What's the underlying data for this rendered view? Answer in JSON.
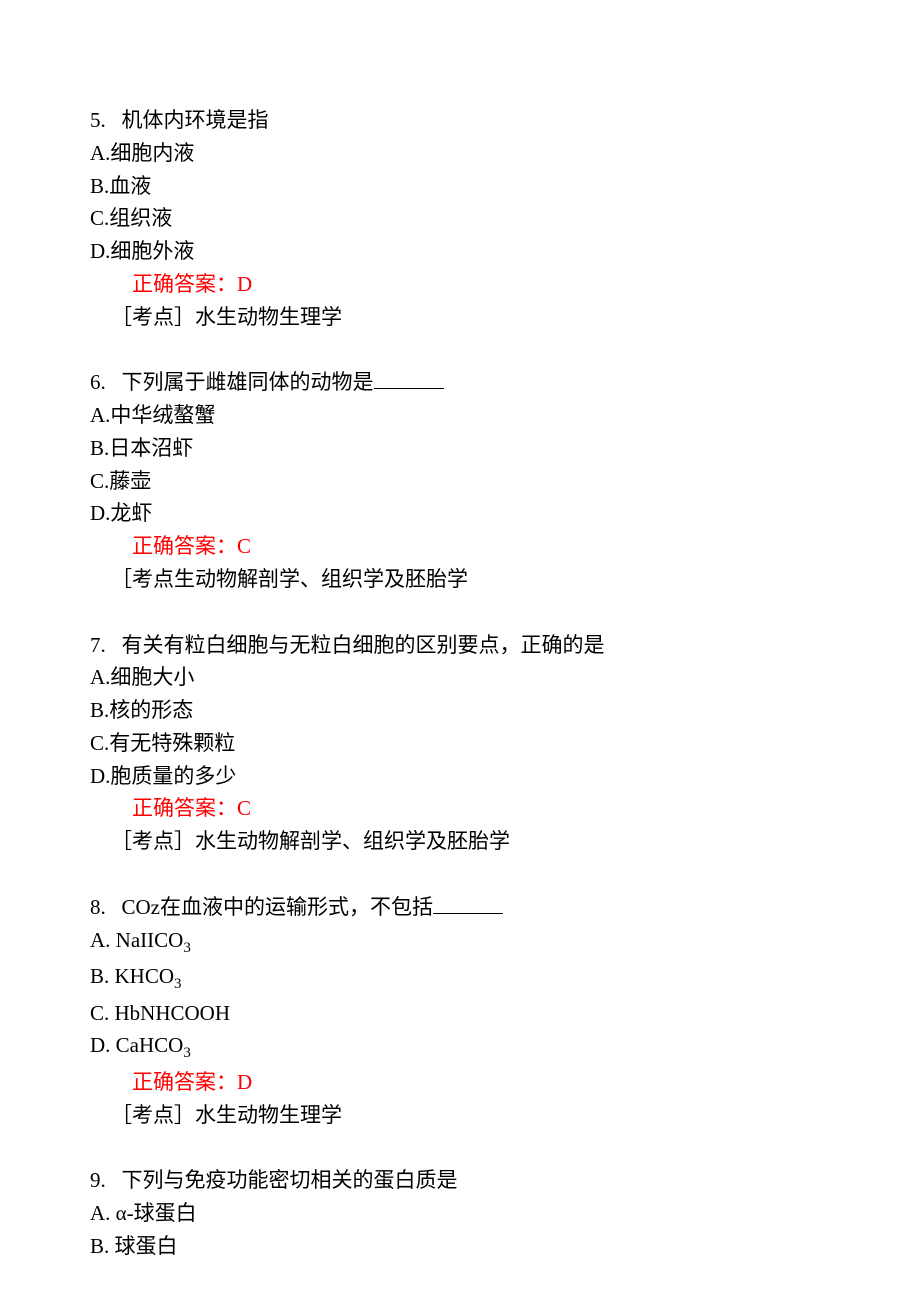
{
  "q5": {
    "num": "5.",
    "text": "机体内环境是指",
    "optA": "A.细胞内液",
    "optB": "B.血液",
    "optC": "C.组织液",
    "optD": "D.细胞外液",
    "answer": "正确答案：D",
    "point": "［考点］水生动物生理学"
  },
  "q6": {
    "num": "6.",
    "text_before": "下列属于雌雄同体的动物是",
    "optA": "A.中华绒螯蟹",
    "optB": "B.日本沼虾",
    "optC": "C.藤壶",
    "optD": "D.龙虾",
    "answer": "正确答案：C",
    "point": "［考点生动物解剖学、组织学及胚胎学"
  },
  "q7": {
    "num": "7.",
    "text": "有关有粒白细胞与无粒白细胞的区别要点，正确的是",
    "optA": "A.细胞大小",
    "optB": "B.核的形态",
    "optC": "C.有无特殊颗粒",
    "optD": "D.胞质量的多少",
    "answer": "正确答案：C",
    "point": "［考点］水生动物解剖学、组织学及胚胎学"
  },
  "q8": {
    "num": "8.",
    "text_before": "COz在血液中的运输形式，不包括",
    "optA_pre": "A. NaIICO",
    "optA_sub": "3",
    "optB_pre": "B. KHCO",
    "optB_sub": "3",
    "optC": "C. HbNHCOOH",
    "optD_pre": "D. CaHCO",
    "optD_sub": "3",
    "answer": "正确答案：D",
    "point": "［考点］水生动物生理学"
  },
  "q9": {
    "num": "9.",
    "text": "下列与免疫功能密切相关的蛋白质是",
    "optA": "A. α-球蛋白",
    "optB": "B. 球蛋白"
  }
}
